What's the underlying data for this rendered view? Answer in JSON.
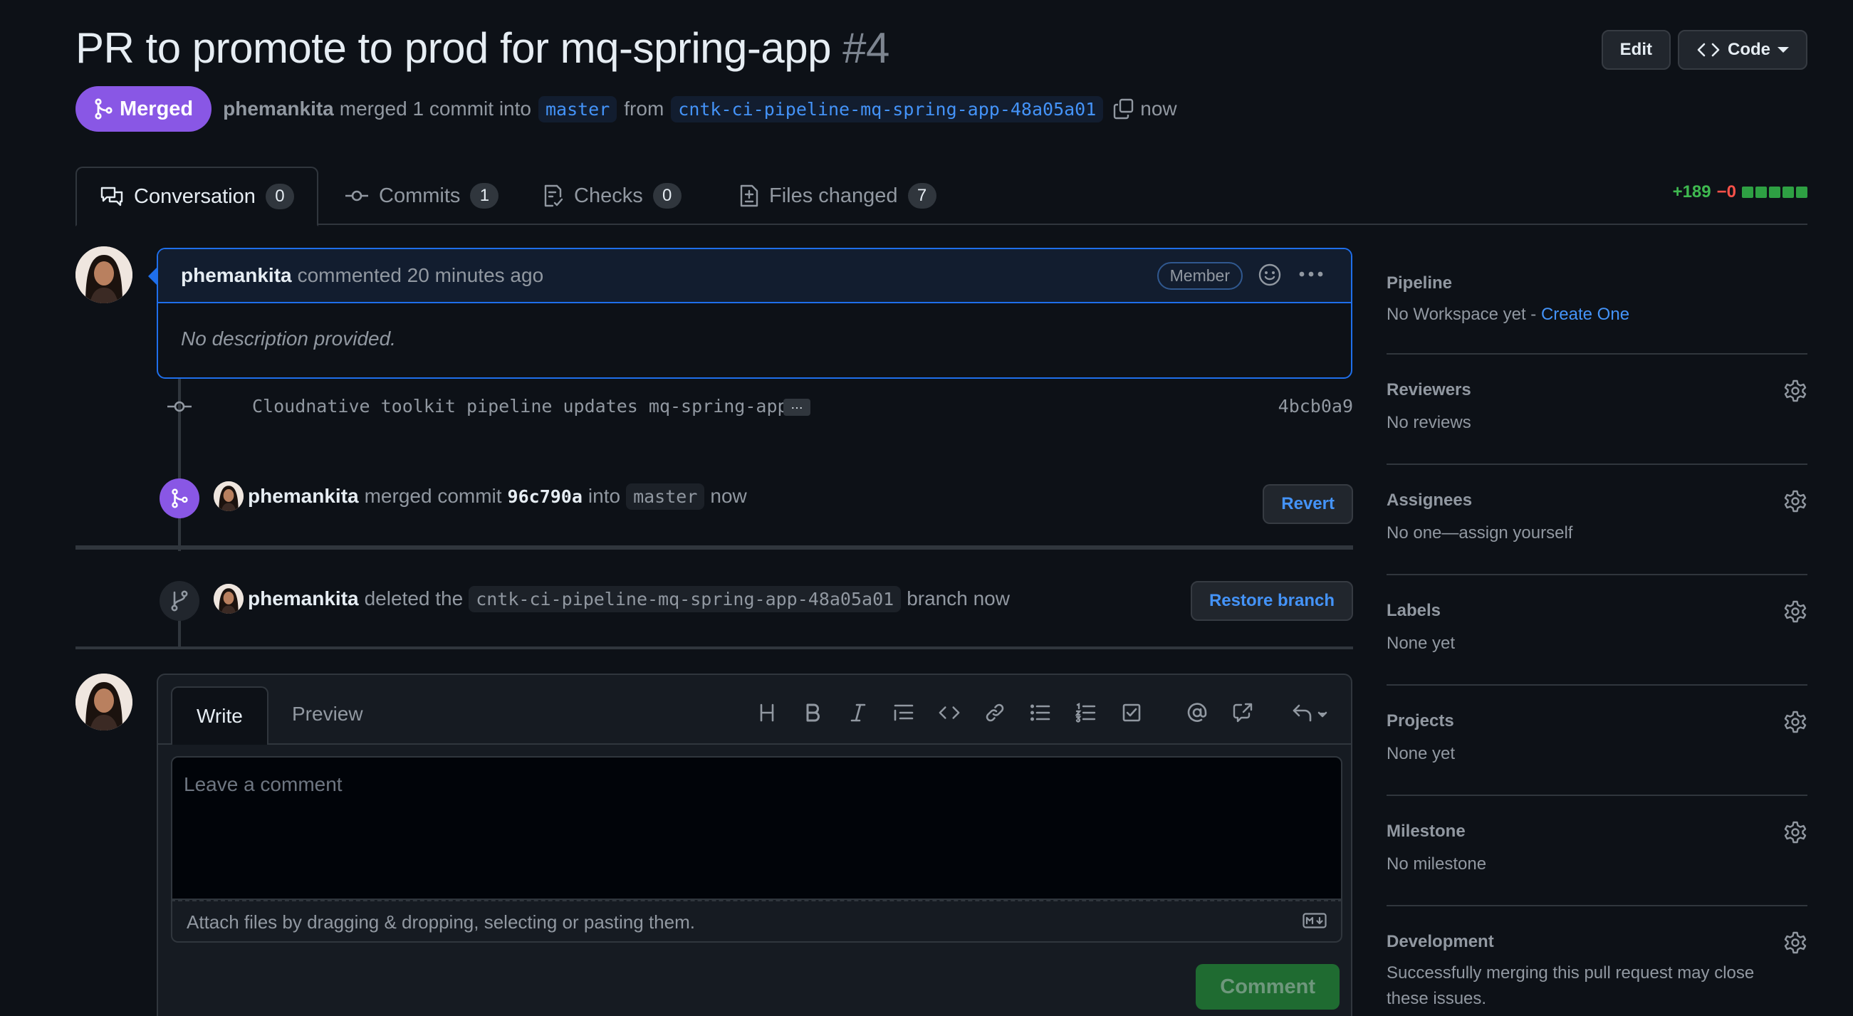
{
  "pr": {
    "title": "PR to promote to prod for mq-spring-app",
    "number": "#4",
    "status": "Merged",
    "author": "phemankita",
    "merge_text": "merged 1 commit into",
    "base_branch": "master",
    "from_text": "from",
    "head_branch": "cntk-ci-pipeline-mq-spring-app-48a05a01",
    "time": "now"
  },
  "header_actions": {
    "edit": "Edit",
    "code": "Code"
  },
  "tabs": [
    {
      "label": "Conversation",
      "count": "0"
    },
    {
      "label": "Commits",
      "count": "1"
    },
    {
      "label": "Checks",
      "count": "0"
    },
    {
      "label": "Files changed",
      "count": "7"
    }
  ],
  "diffstat": {
    "additions": "+189",
    "deletions": "−0"
  },
  "comment": {
    "author": "phemankita",
    "action": "commented 20 minutes ago",
    "role": "Member",
    "body": "No description provided."
  },
  "commit": {
    "message": "Cloudnative toolkit pipeline updates mq-spring-app",
    "ellipsis": "…",
    "sha": "4bcb0a9"
  },
  "merge_event": {
    "author": "phemankita",
    "text1": "merged commit",
    "sha": "96c790a",
    "text2": "into",
    "branch": "master",
    "time": "now",
    "button": "Revert"
  },
  "delete_event": {
    "author": "phemankita",
    "text1": "deleted the",
    "branch": "cntk-ci-pipeline-mq-spring-app-48a05a01",
    "text2": "branch now",
    "button": "Restore branch"
  },
  "composer": {
    "tab_write": "Write",
    "tab_preview": "Preview",
    "placeholder": "Leave a comment",
    "attach_hint": "Attach files by dragging & dropping, selecting or pasting them.",
    "submit": "Comment"
  },
  "sidebar": {
    "pipeline": {
      "title": "Pipeline",
      "value": "No Workspace yet - ",
      "link": "Create One"
    },
    "reviewers": {
      "title": "Reviewers",
      "value": "No reviews"
    },
    "assignees": {
      "title": "Assignees",
      "value": "No one—assign yourself"
    },
    "labels": {
      "title": "Labels",
      "value": "None yet"
    },
    "projects": {
      "title": "Projects",
      "value": "None yet"
    },
    "milestone": {
      "title": "Milestone",
      "value": "No milestone"
    },
    "development": {
      "title": "Development",
      "value": "Successfully merging this pull request may close these issues."
    }
  },
  "colors": {
    "merged": "#8957e5",
    "link": "#4493f8",
    "add": "#3fb950",
    "del": "#f85149",
    "submit": "#238636"
  }
}
